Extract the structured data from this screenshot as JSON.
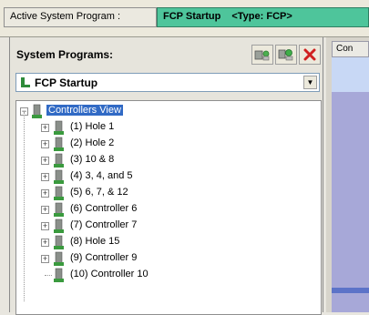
{
  "header": {
    "active_system_label": "Active System Program :",
    "program_name": "FCP Startup",
    "type_label": "<Type: FCP>"
  },
  "system_programs": {
    "label": "System Programs:",
    "selected": "FCP Startup",
    "buttons": [
      "add-program-icon",
      "copy-program-icon",
      "delete-icon"
    ]
  },
  "tree": {
    "root": "Controllers View",
    "items": [
      {
        "label": "(1)  Hole 1"
      },
      {
        "label": "(2)  Hole 2"
      },
      {
        "label": "(3)  10 & 8"
      },
      {
        "label": "(4)  3, 4, and 5"
      },
      {
        "label": "(5)  6, 7, & 12"
      },
      {
        "label": "(6)  Controller 6"
      },
      {
        "label": "(7)  Controller 7"
      },
      {
        "label": "(8)  Hole 15"
      },
      {
        "label": "(9)  Controller 9"
      },
      {
        "label": "(10)  Controller 10"
      }
    ]
  },
  "right_panel": {
    "tab_label": "Con"
  },
  "colors": {
    "program_tab": "#4ec59b",
    "selection": "#316ac5",
    "panel_blue": "#a7a8d8"
  }
}
